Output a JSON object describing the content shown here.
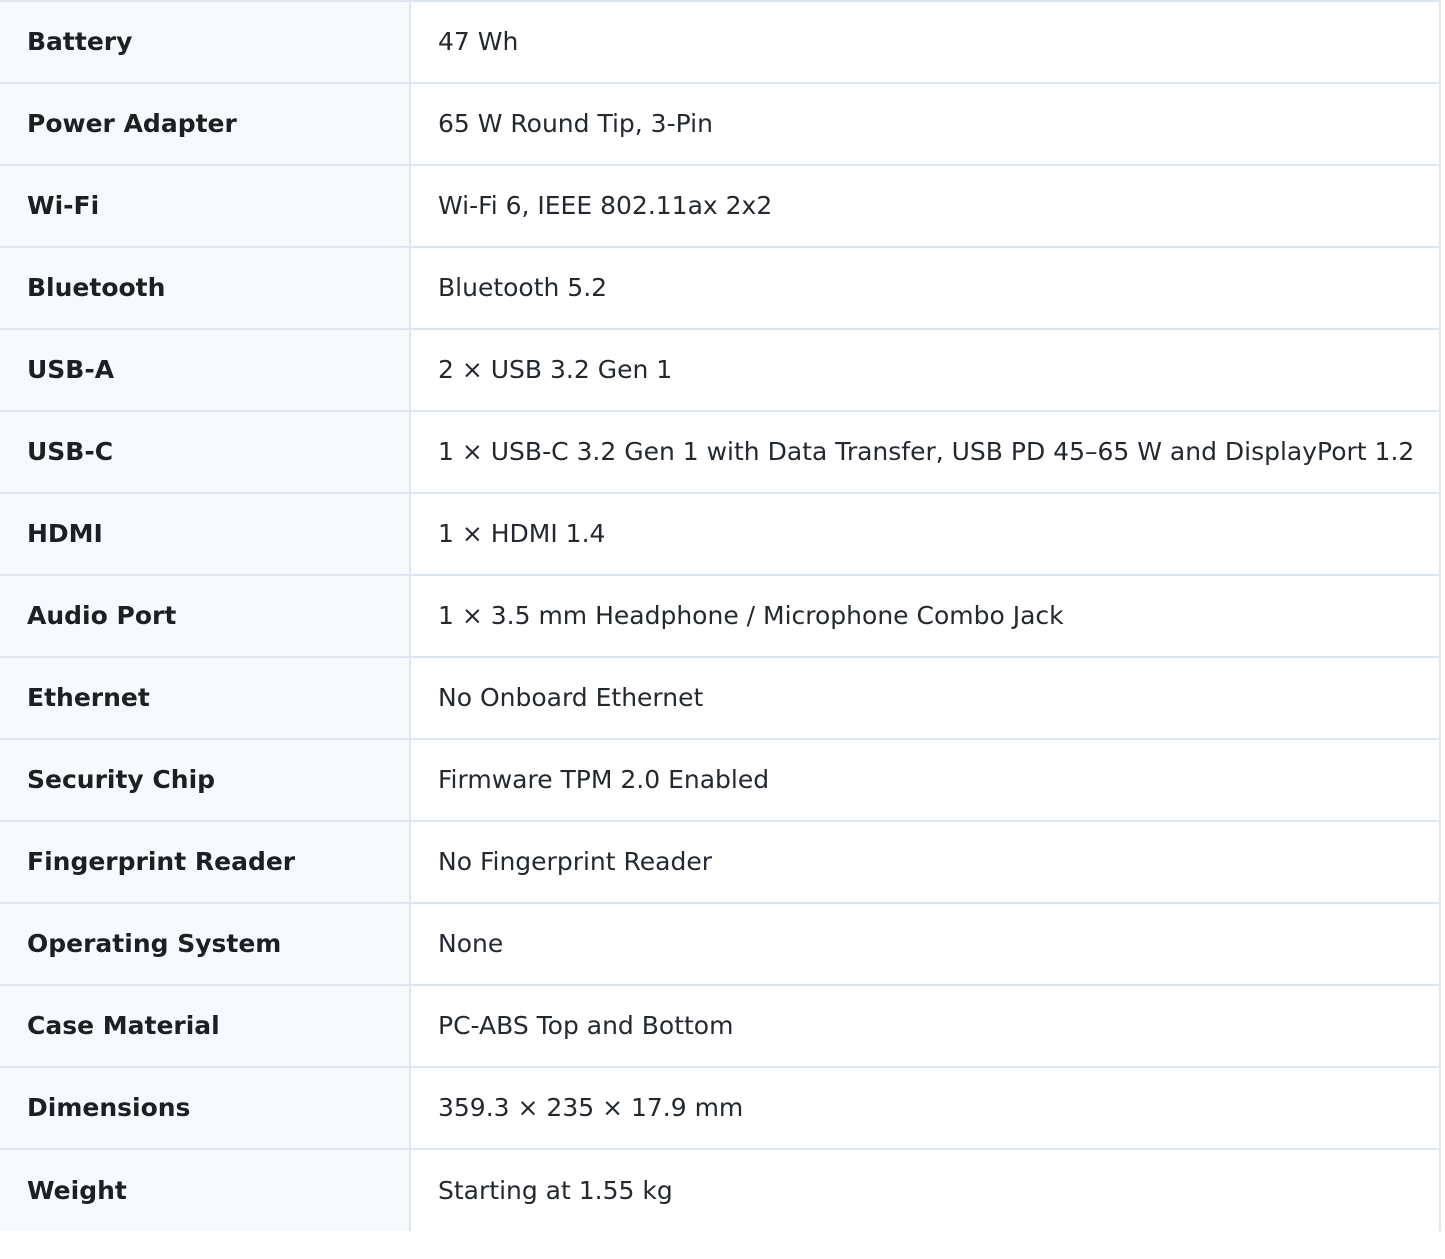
{
  "specs": [
    {
      "label": "Battery",
      "value": "47 Wh"
    },
    {
      "label": "Power Adapter",
      "value": "65 W Round Tip, 3-Pin"
    },
    {
      "label": "Wi-Fi",
      "value": "Wi-Fi 6, IEEE 802.11ax 2x2"
    },
    {
      "label": "Bluetooth",
      "value": "Bluetooth 5.2"
    },
    {
      "label": "USB-A",
      "value": "2 × USB 3.2 Gen 1"
    },
    {
      "label": "USB-C",
      "value": "1 × USB-C 3.2 Gen 1 with Data Transfer, USB PD 45–65 W and DisplayPort 1.2"
    },
    {
      "label": "HDMI",
      "value": "1 × HDMI 1.4"
    },
    {
      "label": "Audio Port",
      "value": "1 × 3.5 mm Headphone / Microphone Combo Jack"
    },
    {
      "label": "Ethernet",
      "value": "No Onboard Ethernet"
    },
    {
      "label": "Security Chip",
      "value": "Firmware TPM 2.0 Enabled"
    },
    {
      "label": "Fingerprint Reader",
      "value": "No Fingerprint Reader"
    },
    {
      "label": "Operating System",
      "value": "None"
    },
    {
      "label": "Case Material",
      "value": "PC-ABS Top and Bottom"
    },
    {
      "label": "Dimensions",
      "value": "359.3 × 235 × 17.9 mm"
    },
    {
      "label": "Weight",
      "value": "Starting at 1.55 kg"
    }
  ]
}
